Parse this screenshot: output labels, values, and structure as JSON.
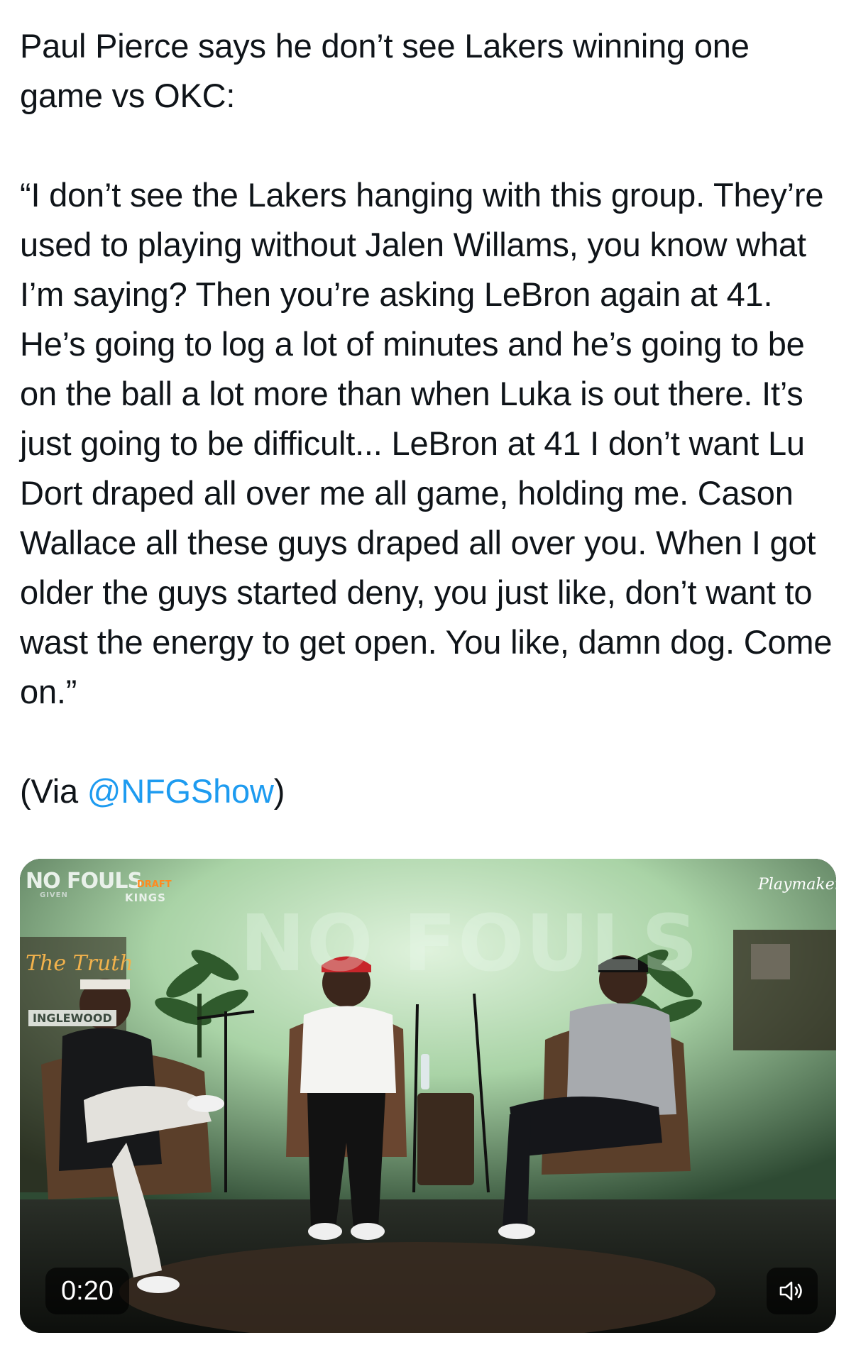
{
  "post": {
    "heading": "Paul Pierce says he don’t see Lakers winning one game vs OKC:",
    "quote": "“I don’t see the Lakers hanging with this group. They’re used to playing without Jalen Willams, you know what I’m saying? Then you’re asking LeBron again at 41. He’s going to log a lot of minutes and he’s going to be on the ball a lot more than when Luka is out there. It’s just going to be difficult... LeBron at 41 I don’t want Lu Dort draped all over me all game, holding me. Cason Wallace all these guys draped all over you. When I got older the guys started deny, you just like, don’t want to wast the energy to get open. You like, damn dog. Come on.”",
    "via_prefix": "(Via ",
    "via_handle": "@NFGShow",
    "via_suffix": ")"
  },
  "video": {
    "timestamp": "0:20",
    "volume_icon": "speaker-icon",
    "logos": {
      "show_logo": "NO FOULS",
      "show_logo_sub": "GIVEN",
      "sponsor_top": "DRAFT",
      "sponsor_bottom": "KINGS",
      "network": "Playmaker",
      "wall_logo": "NO FOULS",
      "neon_sign": "The Truth",
      "street_sign": "INGLEWOOD"
    }
  },
  "colors": {
    "link": "#1d9bf0",
    "text": "#0f1419",
    "studio_wall": "#cfe6cf"
  }
}
